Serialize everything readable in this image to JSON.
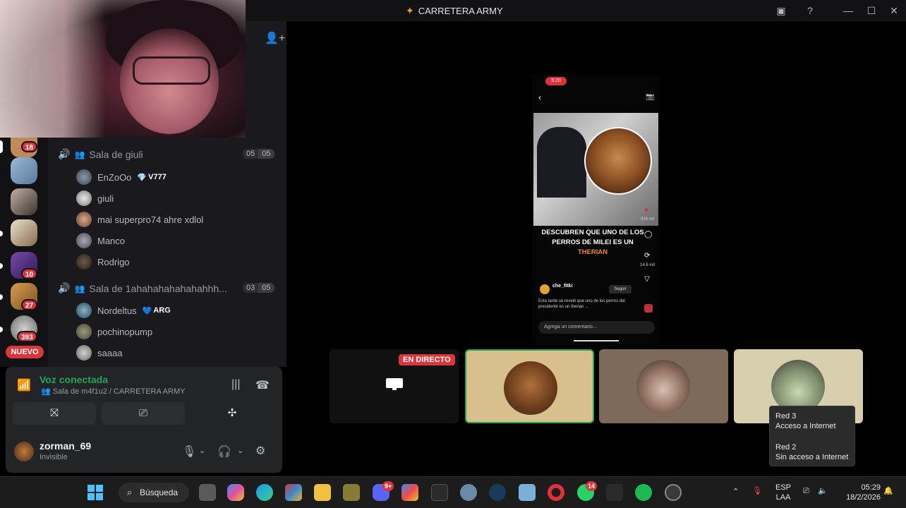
{
  "window": {
    "title": "CARRETERA ARMY"
  },
  "servers": {
    "badges": [
      "18",
      "10",
      "27",
      "393"
    ],
    "new_label": "NUEVO"
  },
  "rooms": [
    {
      "name": "Sala de giuli",
      "count_a": "05",
      "count_b": "05",
      "members": [
        {
          "name": "EnZoOo",
          "tag": "V777"
        },
        {
          "name": "giuli"
        },
        {
          "name": "mai superpro74 ahre xdlol"
        },
        {
          "name": "Manco"
        },
        {
          "name": "Rodrigo"
        }
      ]
    },
    {
      "name": "Sala de 1ahahahahahahahhh...",
      "count_a": "03",
      "count_b": "05",
      "members": [
        {
          "name": "Nordeltus",
          "tag": "ARG"
        },
        {
          "name": "pochinopump"
        },
        {
          "name": "saaaa"
        }
      ]
    }
  ],
  "voice": {
    "status": "Voz conectada",
    "channel": "Sala de m4f1u2 / CARRETERA ARMY"
  },
  "user": {
    "name": "zorman_69",
    "status": "Invisible"
  },
  "stream": {
    "phone_time": "5:20",
    "headline": "DESCUBREN QUE UNO DE LOS PERROS DE MILEI ES UN",
    "headline_highlight": "THERIAN",
    "likes": "924 mil",
    "shares": "14.6 mil",
    "account": "che_fitki",
    "follow": "Seguir",
    "caption": "Esta tarde se reveló que uno de los perros del presidente es un therian ...",
    "comment_placeholder": "Agrega un comentario...",
    "live_label": "EN DIRECTO"
  },
  "wifi_popup": {
    "net1_name": "Red 3",
    "net1_status": "Acceso a Internet",
    "net2_name": "Red 2",
    "net2_status": "Sin acceso a Internet"
  },
  "taskbar": {
    "search_label": "Búsqueda",
    "discord_badge": "9+",
    "whatsapp_badge": "14",
    "lang_top": "ESP",
    "lang_bottom": "LAA",
    "time": "05:29",
    "date": "18/2/2026"
  }
}
